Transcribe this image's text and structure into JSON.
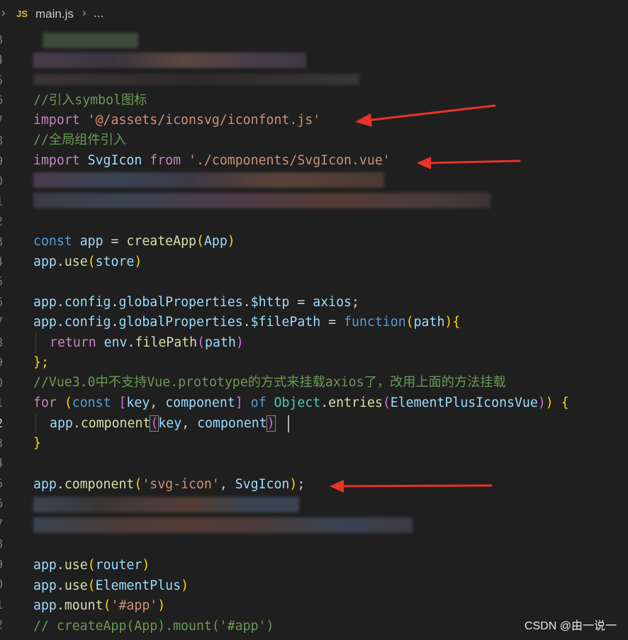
{
  "breadcrumb": {
    "file_icon": "JS",
    "file": "main.js",
    "more": "..."
  },
  "line_numbers": [
    "3",
    "4",
    "5",
    "6",
    "7",
    "8",
    "9",
    "0",
    "1",
    "2",
    "3",
    "4",
    "5",
    "6",
    "7",
    "8",
    "9",
    "0",
    "1",
    "2",
    "3",
    "4",
    "5",
    "6",
    "7",
    "8",
    "9",
    "0",
    "1",
    "2"
  ],
  "active_line_index": 19,
  "lines": {
    "l6": {
      "comment": "//引入symbol图标"
    },
    "l7": {
      "kw": "import",
      "str": "'@/assets/iconsvg/iconfont.js'"
    },
    "l8": {
      "comment": "//全局组件引入"
    },
    "l9": {
      "kw": "import",
      "ident": "SvgIcon",
      "kw_from": "from",
      "str": "'./components/SvgIcon.vue'"
    },
    "l13": {
      "kw": "const",
      "var": "app",
      "op": "=",
      "fn": "createApp",
      "arg": "App"
    },
    "l14": {
      "obj": "app",
      "fn": "use",
      "arg": "store"
    },
    "l16": {
      "obj": "app",
      "p1": "config",
      "p2": "globalProperties",
      "p3": "$http",
      "op": "=",
      "val": "axios",
      "semi": ";"
    },
    "l17": {
      "obj": "app",
      "p1": "config",
      "p2": "globalProperties",
      "p3": "$filePath",
      "op": "=",
      "kw": "function",
      "param": "path",
      "brace": "{"
    },
    "l18": {
      "kw": "return",
      "obj": "env",
      "fn": "filePath",
      "arg": "path"
    },
    "l19": {
      "close": "};"
    },
    "l20": {
      "comment": "//Vue3.0中不支持Vue.prototype的方式来挂载axios了，改用上面的方法挂载"
    },
    "l21": {
      "kw": "for",
      "kw_const": "const",
      "v1": "key",
      "v2": "component",
      "kw_of": "of",
      "cls": "Object",
      "fn": "entries",
      "arg": "ElementPlusIconsVue",
      "brace": "{"
    },
    "l22": {
      "obj": "app",
      "fn": "component",
      "a1": "key",
      "a2": "component"
    },
    "l23": {
      "close": "}"
    },
    "l25": {
      "obj": "app",
      "fn": "component",
      "str": "'svg-icon'",
      "arg": "SvgIcon",
      "semi": ";"
    },
    "l29": {
      "obj": "app",
      "fn": "use",
      "arg": "router"
    },
    "l30": {
      "obj": "app",
      "fn": "use",
      "arg": "ElementPlus"
    },
    "l31": {
      "obj": "app",
      "fn": "mount",
      "str": "'#app'"
    },
    "l32": {
      "comment": "// createApp(App).mount('#app')"
    }
  },
  "colors": {
    "arrow": "#e8322b",
    "background": "#1f1f1f"
  },
  "watermark": "CSDN @由一说一"
}
